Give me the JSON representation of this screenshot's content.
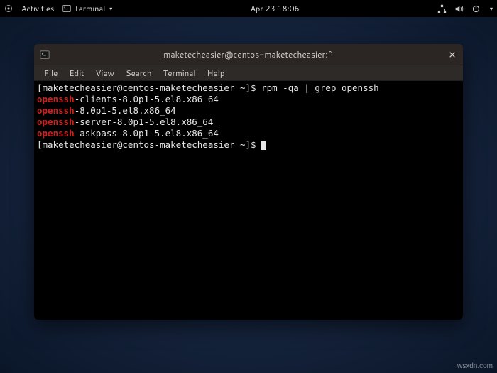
{
  "topbar": {
    "activities": "Activities",
    "app_name": "Terminal",
    "datetime": "Apr 23  18:06"
  },
  "window": {
    "title": "maketecheasier@centos-maketecheasier:~"
  },
  "menubar": {
    "file": "File",
    "edit": "Edit",
    "view": "View",
    "search": "Search",
    "terminal": "Terminal",
    "help": "Help"
  },
  "terminal": {
    "prompt1_pre": "[maketecheasier@centos-maketecheasier ~]$ ",
    "cmd1": "rpm -qa | grep openssh",
    "hl": "openssh",
    "line1_suffix": "-clients-8.0p1-5.el8.x86_64",
    "line2_suffix": "-8.0p1-5.el8.x86_64",
    "line3_suffix": "-server-8.0p1-5.el8.x86_64",
    "line4_suffix": "-askpass-8.0p1-5.el8.x86_64",
    "prompt2_pre": "[maketecheasier@centos-maketecheasier ~]$ "
  },
  "watermark": "wsxdn.com"
}
